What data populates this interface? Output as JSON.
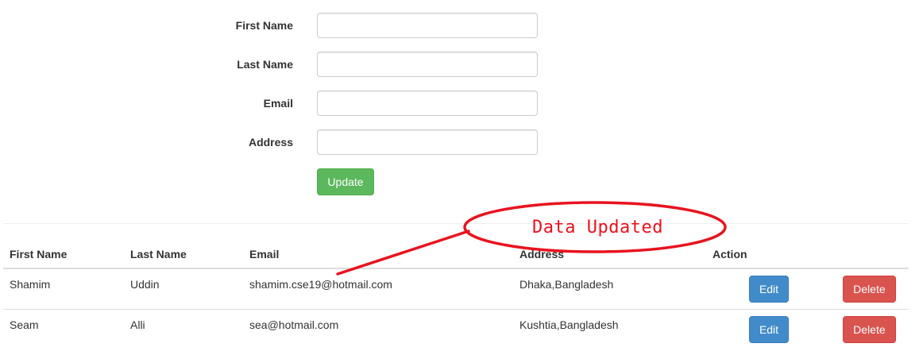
{
  "form": {
    "fields": [
      {
        "label": "First Name",
        "value": "",
        "placeholder": ""
      },
      {
        "label": "Last Name",
        "value": "",
        "placeholder": ""
      },
      {
        "label": "Email",
        "value": "",
        "placeholder": ""
      },
      {
        "label": "Address",
        "value": "",
        "placeholder": ""
      }
    ],
    "submit_label": "Update",
    "submit_color": "#5cb85c"
  },
  "table": {
    "headers": [
      "First Name",
      "Last Name",
      "Email",
      "Address",
      "Action"
    ],
    "rows": [
      {
        "first_name": "Shamim",
        "last_name": "Uddin",
        "email": "shamim.cse19@hotmail.com",
        "address": "Dhaka,Bangladesh",
        "edit_label": "Edit",
        "delete_label": "Delete"
      },
      {
        "first_name": "Seam",
        "last_name": "Alli",
        "email": "sea@hotmail.com",
        "address": "Kushtia,Bangladesh",
        "edit_label": "Edit",
        "delete_label": "Delete"
      }
    ],
    "edit_color": "#428bca",
    "delete_color": "#d9534f"
  },
  "annotation": {
    "text": "Data Updated",
    "color": "#e8131f"
  }
}
